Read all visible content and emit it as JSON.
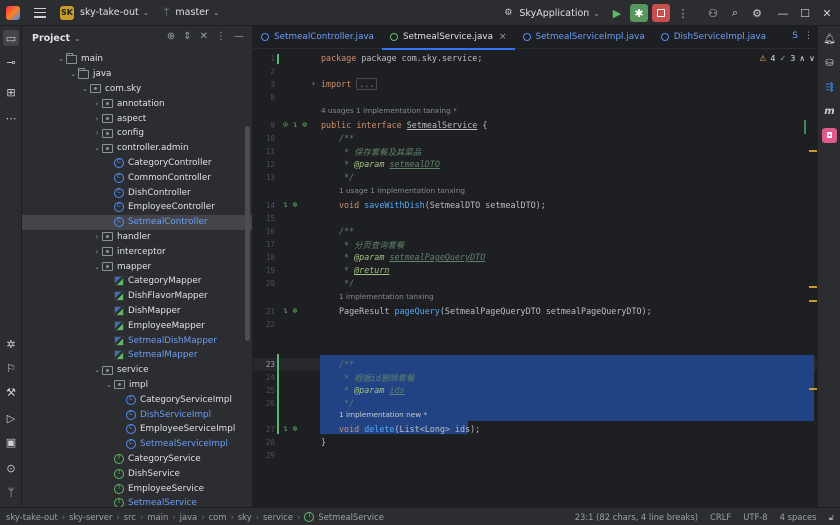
{
  "titlebar": {
    "project_badge": "SK",
    "project_name": "sky-take-out",
    "branch": "master",
    "run_config": "SkyApplication"
  },
  "project_panel": {
    "title": "Project",
    "tree": [
      {
        "label": "main",
        "kind": "folder",
        "indent": 3,
        "open": true
      },
      {
        "label": "java",
        "kind": "folder",
        "indent": 4,
        "open": true
      },
      {
        "label": "com.sky",
        "kind": "pkg",
        "indent": 5,
        "open": true
      },
      {
        "label": "annotation",
        "kind": "pkg",
        "indent": 6,
        "open": false
      },
      {
        "label": "aspect",
        "kind": "pkg",
        "indent": 6,
        "open": false
      },
      {
        "label": "config",
        "kind": "pkg",
        "indent": 6,
        "open": false
      },
      {
        "label": "controller.admin",
        "kind": "pkg",
        "indent": 6,
        "open": true
      },
      {
        "label": "CategoryController",
        "kind": "cls",
        "indent": 7,
        "color": "norm"
      },
      {
        "label": "CommonController",
        "kind": "cls",
        "indent": 7,
        "color": "norm"
      },
      {
        "label": "DishController",
        "kind": "cls",
        "indent": 7,
        "color": "norm"
      },
      {
        "label": "EmployeeController",
        "kind": "cls",
        "indent": 7,
        "color": "norm"
      },
      {
        "label": "SetmealController",
        "kind": "cls",
        "indent": 7,
        "color": "blue",
        "selected": true
      },
      {
        "label": "handler",
        "kind": "pkg",
        "indent": 6,
        "open": false
      },
      {
        "label": "interceptor",
        "kind": "pkg",
        "indent": 6,
        "open": false
      },
      {
        "label": "mapper",
        "kind": "pkg",
        "indent": 6,
        "open": true
      },
      {
        "label": "CategoryMapper",
        "kind": "mapper",
        "indent": 7,
        "color": "norm"
      },
      {
        "label": "DishFlavorMapper",
        "kind": "mapper",
        "indent": 7,
        "color": "norm"
      },
      {
        "label": "DishMapper",
        "kind": "mapper",
        "indent": 7,
        "color": "norm"
      },
      {
        "label": "EmployeeMapper",
        "kind": "mapper",
        "indent": 7,
        "color": "norm"
      },
      {
        "label": "SetmealDishMapper",
        "kind": "mapper",
        "indent": 7,
        "color": "blue"
      },
      {
        "label": "SetmealMapper",
        "kind": "mapper",
        "indent": 7,
        "color": "blue"
      },
      {
        "label": "service",
        "kind": "pkg",
        "indent": 6,
        "open": true
      },
      {
        "label": "impl",
        "kind": "pkg",
        "indent": 7,
        "open": true
      },
      {
        "label": "CategoryServiceImpl",
        "kind": "cls",
        "indent": 8,
        "color": "norm"
      },
      {
        "label": "DishServiceImpl",
        "kind": "cls",
        "indent": 8,
        "color": "blue"
      },
      {
        "label": "EmployeeServiceImpl",
        "kind": "cls",
        "indent": 8,
        "color": "norm"
      },
      {
        "label": "SetmealServiceImpl",
        "kind": "cls",
        "indent": 8,
        "color": "blue"
      },
      {
        "label": "CategoryService",
        "kind": "itf",
        "indent": 7,
        "color": "norm"
      },
      {
        "label": "DishService",
        "kind": "itf",
        "indent": 7,
        "color": "norm"
      },
      {
        "label": "EmployeeService",
        "kind": "itf",
        "indent": 7,
        "color": "norm"
      },
      {
        "label": "SetmealService",
        "kind": "itf",
        "indent": 7,
        "color": "blue"
      }
    ]
  },
  "editor": {
    "tabs": [
      {
        "label": "SetmealController.java",
        "kind": "cls",
        "active": false,
        "color": "blue"
      },
      {
        "label": "SetmealService.java",
        "kind": "itf",
        "active": true,
        "color": "norm"
      },
      {
        "label": "SetmealServiceImpl.java",
        "kind": "cls",
        "active": false,
        "color": "blue"
      },
      {
        "label": "DishServiceImpl.java",
        "kind": "cls",
        "active": false,
        "color": "blue"
      }
    ],
    "tab_overflow": "S",
    "warnings": "4",
    "weak_warnings": "3",
    "lines": {
      "l1": "package com.sky.service;",
      "l3_kw": "import",
      "l3_fold": "...",
      "l9_kw1": "public",
      "l9_kw2": "interface",
      "l9_name": "SetmealService",
      "l9_rest": " {",
      "l10": "/**",
      "l11": " * 保存套餐及其菜品",
      "l12_tag": "@param",
      "l12_id": "setmealDTO",
      "l13": " */",
      "l14_kw": "void",
      "l14_fn": "saveWithDish",
      "l14_rest": "(SetmealDTO setmealDTO);",
      "l16": "/**",
      "l17": " * 分页查询套餐",
      "l18_tag": "@param",
      "l18_id": "setmealPageQueryDTO",
      "l19_tag": "@return",
      "l20": " */",
      "l21_type": "PageResult ",
      "l21_fn": "pageQuery",
      "l21_rest": "(SetmealPageQueryDTO setmealPageQueryDTO);",
      "l23": "/**",
      "l24": " * 根据id删除套餐",
      "l25_tag": "@param",
      "l25_id": "ids",
      "l26": " */",
      "l27_kw": "void",
      "l27_fn": "delete",
      "l27_rest": "(List<Long> ids);",
      "l28": "}"
    },
    "inlays": {
      "i9": "4 usages    1 implementation    tanxing *",
      "i14": "1 usage    1 implementation    tanxing",
      "i21": "1 implementation    tanxing",
      "i27": "1 implementation    new *"
    }
  },
  "statusbar": {
    "breadcrumb": [
      "sky-take-out",
      "sky-server",
      "src",
      "main",
      "java",
      "com",
      "sky",
      "service",
      "SetmealService"
    ],
    "position": "23:1 (82 chars, 4 line breaks)",
    "line_sep": "CRLF",
    "encoding": "UTF-8",
    "indent": "4 spaces"
  }
}
